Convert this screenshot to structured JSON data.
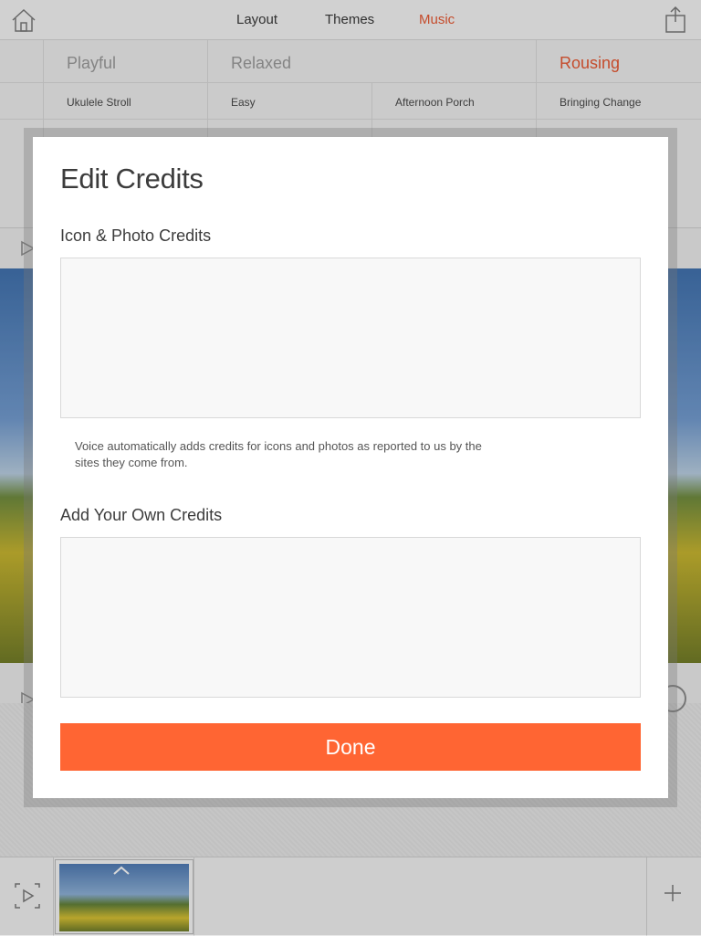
{
  "tabs": [
    {
      "label": "Layout"
    },
    {
      "label": "Themes"
    },
    {
      "label": "Music"
    }
  ],
  "music": {
    "categories": [
      {
        "label": "Playful"
      },
      {
        "label": "Relaxed"
      },
      {
        "label": "Rousing"
      }
    ],
    "tracks": [
      "Ukulele Stroll",
      "Easy",
      "Afternoon Porch",
      "Bringing Change"
    ]
  },
  "modal": {
    "title": "Edit Credits",
    "icon_credits_label": "Icon & Photo Credits",
    "icon_credits_value": "",
    "note": "Voice automatically adds credits for icons and photos as reported to us by the sites they come from.",
    "own_credits_label": "Add Your Own Credits",
    "own_credits_value": "",
    "done_label": "Done"
  },
  "colors": {
    "accent": "#e8552e",
    "done_button": "#ff6533"
  }
}
